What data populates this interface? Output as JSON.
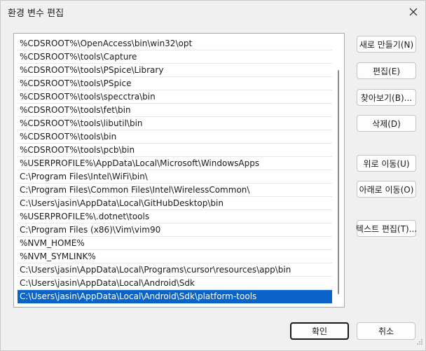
{
  "dialog": {
    "title": "환경 변수 편집"
  },
  "paths": [
    "%CDSROOT%\\OpenAccess\\bin\\win32\\opt",
    "%CDSROOT%\\tools\\Capture",
    "%CDSROOT%\\tools\\PSpice\\Library",
    "%CDSROOT%\\tools\\PSpice",
    "%CDSROOT%\\tools\\specctra\\bin",
    "%CDSROOT%\\tools\\fet\\bin",
    "%CDSROOT%\\tools\\libutil\\bin",
    "%CDSROOT%\\tools\\bin",
    "%CDSROOT%\\tools\\pcb\\bin",
    "%USERPROFILE%\\AppData\\Local\\Microsoft\\WindowsApps",
    "C:\\Program Files\\Intel\\WiFi\\bin\\",
    "C:\\Program Files\\Common Files\\Intel\\WirelessCommon\\",
    "C:\\Users\\jasin\\AppData\\Local\\GitHubDesktop\\bin",
    "%USERPROFILE%\\.dotnet\\tools",
    "C:\\Program Files (x86)\\Vim\\vim90",
    "%NVM_HOME%",
    "%NVM_SYMLINK%",
    "C:\\Users\\jasin\\AppData\\Local\\Programs\\cursor\\resources\\app\\bin",
    "C:\\Users\\jasin\\AppData\\Local\\Android\\Sdk",
    "C:\\Users\\jasin\\AppData\\Local\\Android\\Sdk\\platform-tools"
  ],
  "selected_index": 19,
  "buttons": {
    "new": "새로 만들기(N)",
    "edit": "편집(E)",
    "browse": "찾아보기(B)...",
    "delete": "삭제(D)",
    "move_up": "위로 이동(U)",
    "move_down": "아래로 이동(O)",
    "edit_text": "텍스트 편집(T)...",
    "ok": "확인",
    "cancel": "취소"
  },
  "colors": {
    "selection": "#0a64c8",
    "dialog_bg": "#f0f0f0"
  }
}
